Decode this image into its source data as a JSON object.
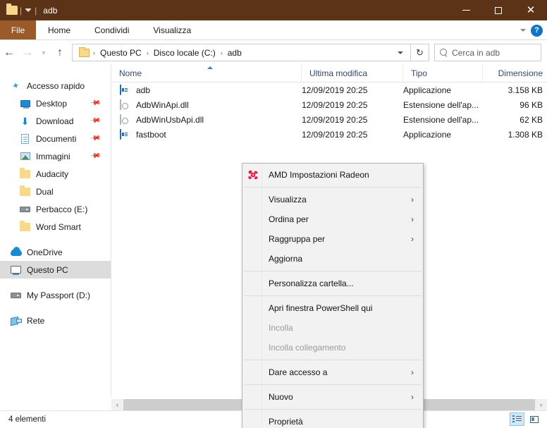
{
  "window": {
    "title": "adb",
    "folder_icon": "folder-icon",
    "quick_access_caret": "chevron-down-icon",
    "separator": "|",
    "controls": {
      "minimize": "minimize-icon",
      "maximize": "maximize-icon",
      "close": "close-icon"
    }
  },
  "ribbon": {
    "file_tab": "File",
    "tabs": [
      "Home",
      "Condividi",
      "Visualizza"
    ],
    "collapse_icon": "chevron-down-icon",
    "help_label": "?"
  },
  "address": {
    "back_icon": "arrow-left-icon",
    "forward_icon": "arrow-right-icon",
    "recent_icon": "chevron-down-icon",
    "up_icon": "arrow-up-icon",
    "folder_icon": "folder-icon",
    "crumbs": [
      "Questo PC",
      "Disco locale (C:)",
      "adb"
    ],
    "crumb_separator": "›",
    "dropdown_icon": "chevron-down-icon",
    "refresh_icon": "↻"
  },
  "search": {
    "icon": "search-icon",
    "placeholder": "Cerca in adb",
    "value": ""
  },
  "sidebar": {
    "items": [
      {
        "label": "Accesso rapido",
        "icon": "star-pin-icon",
        "indent": false,
        "pinned": false,
        "selected": false
      },
      {
        "label": "Desktop",
        "icon": "desktop-icon",
        "indent": true,
        "pinned": true,
        "selected": false
      },
      {
        "label": "Download",
        "icon": "download-icon",
        "indent": true,
        "pinned": true,
        "selected": false
      },
      {
        "label": "Documenti",
        "icon": "documents-icon",
        "indent": true,
        "pinned": true,
        "selected": false
      },
      {
        "label": "Immagini",
        "icon": "pictures-icon",
        "indent": true,
        "pinned": true,
        "selected": false
      },
      {
        "label": "Audacity",
        "icon": "folder-icon",
        "indent": true,
        "pinned": false,
        "selected": false
      },
      {
        "label": "Dual",
        "icon": "folder-icon",
        "indent": true,
        "pinned": false,
        "selected": false
      },
      {
        "label": "Perbacco (E:)",
        "icon": "drive-icon",
        "indent": true,
        "pinned": false,
        "selected": false
      },
      {
        "label": "Word Smart",
        "icon": "folder-icon",
        "indent": true,
        "pinned": false,
        "selected": false
      },
      {
        "label": "OneDrive",
        "icon": "cloud-icon",
        "indent": false,
        "pinned": false,
        "selected": false
      },
      {
        "label": "Questo PC",
        "icon": "this-pc-icon",
        "indent": false,
        "pinned": false,
        "selected": true
      },
      {
        "label": "My Passport (D:)",
        "icon": "drive-icon",
        "indent": false,
        "pinned": false,
        "selected": false
      },
      {
        "label": "Rete",
        "icon": "network-icon",
        "indent": false,
        "pinned": false,
        "selected": false
      }
    ]
  },
  "filelist": {
    "columns": [
      "Nome",
      "Ultima modifica",
      "Tipo",
      "Dimensione"
    ],
    "sort_column": "Nome",
    "sort_direction": "ascending",
    "rows": [
      {
        "name": "adb",
        "modified": "12/09/2019 20:25",
        "type": "Applicazione",
        "size": "3.158 KB",
        "icon": "application-icon"
      },
      {
        "name": "AdbWinApi.dll",
        "modified": "12/09/2019 20:25",
        "type": "Estensione dell'ap...",
        "size": "96 KB",
        "icon": "dll-icon"
      },
      {
        "name": "AdbWinUsbApi.dll",
        "modified": "12/09/2019 20:25",
        "type": "Estensione dell'ap...",
        "size": "62 KB",
        "icon": "dll-icon"
      },
      {
        "name": "fastboot",
        "modified": "12/09/2019 20:25",
        "type": "Applicazione",
        "size": "1.308 KB",
        "icon": "application-icon"
      }
    ]
  },
  "context_menu": {
    "items": [
      {
        "label": "AMD Impostazioni Radeon",
        "icon": "amd-radeon-icon",
        "submenu": false,
        "disabled": false,
        "separator_after": true
      },
      {
        "label": "Visualizza",
        "icon": null,
        "submenu": true,
        "disabled": false,
        "separator_after": false
      },
      {
        "label": "Ordina per",
        "icon": null,
        "submenu": true,
        "disabled": false,
        "separator_after": false
      },
      {
        "label": "Raggruppa per",
        "icon": null,
        "submenu": true,
        "disabled": false,
        "separator_after": false
      },
      {
        "label": "Aggiorna",
        "icon": null,
        "submenu": false,
        "disabled": false,
        "separator_after": true
      },
      {
        "label": "Personalizza cartella...",
        "icon": null,
        "submenu": false,
        "disabled": false,
        "separator_after": true
      },
      {
        "label": "Apri finestra PowerShell qui",
        "icon": null,
        "submenu": false,
        "disabled": false,
        "separator_after": false
      },
      {
        "label": "Incolla",
        "icon": null,
        "submenu": false,
        "disabled": true,
        "separator_after": false
      },
      {
        "label": "Incolla collegamento",
        "icon": null,
        "submenu": false,
        "disabled": true,
        "separator_after": true
      },
      {
        "label": "Dare accesso a",
        "icon": null,
        "submenu": true,
        "disabled": false,
        "separator_after": true
      },
      {
        "label": "Nuovo",
        "icon": null,
        "submenu": true,
        "disabled": false,
        "separator_after": true
      },
      {
        "label": "Proprietà",
        "icon": null,
        "submenu": false,
        "disabled": false,
        "separator_after": false
      }
    ],
    "submenu_arrow": "›"
  },
  "scrollbar": {
    "left_arrow": "‹",
    "right_arrow": "›"
  },
  "statusbar": {
    "item_count": "4 elementi",
    "view_details_icon": "details-view-icon",
    "view_icons_icon": "large-icons-view-icon",
    "active_view": "details"
  },
  "colors": {
    "titlebar": "#5c3317",
    "file_tab": "#9a5a2a",
    "accent": "#1173c4",
    "selection": "#dcdcdc",
    "column_header_text": "#32476b"
  }
}
